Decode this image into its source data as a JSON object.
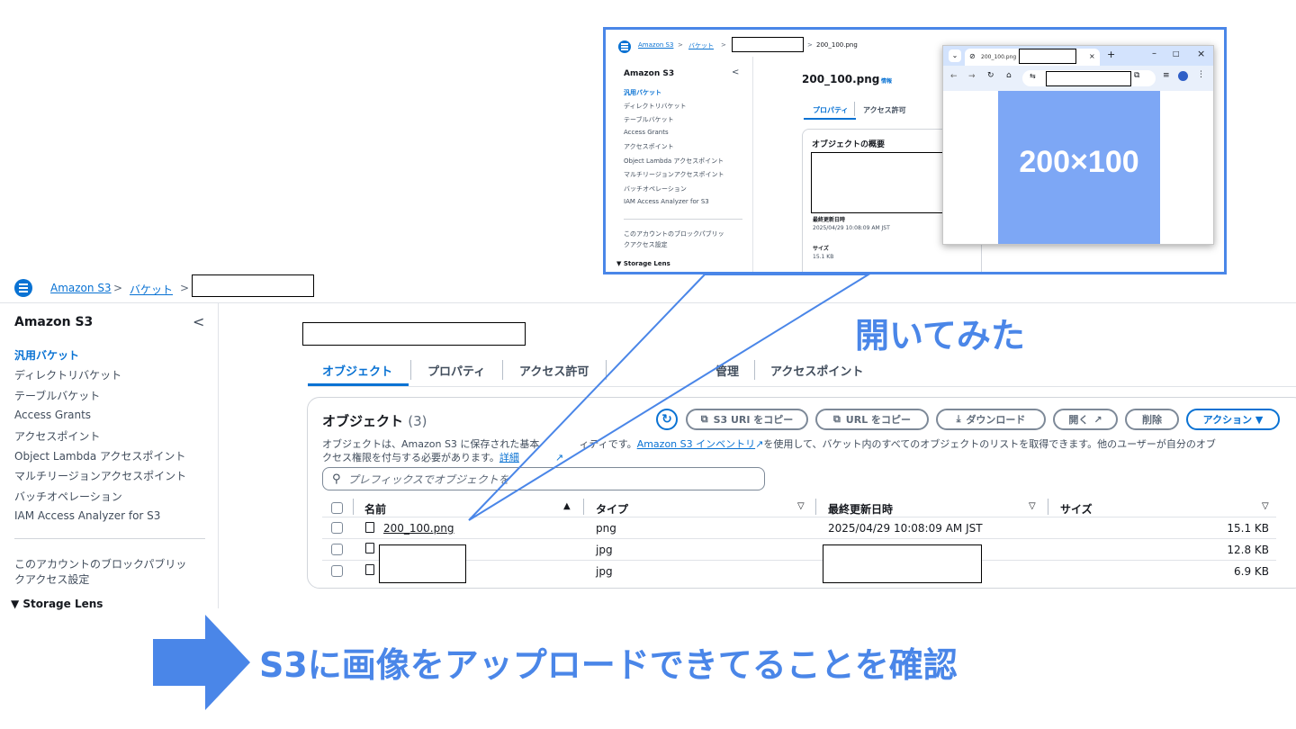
{
  "breadcrumb": {
    "root": "Amazon S3",
    "buckets": "バケット",
    "sep": ">"
  },
  "sidebar": {
    "title": "Amazon S3",
    "collapse_glyph": "<",
    "items": [
      {
        "label": "汎用バケット",
        "active": true
      },
      {
        "label": "ディレクトリバケット"
      },
      {
        "label": "テーブルバケット"
      },
      {
        "label": "Access Grants"
      },
      {
        "label": "アクセスポイント"
      },
      {
        "label": "Object Lambda アクセスポイント"
      },
      {
        "label": "マルチリージョンアクセスポイント"
      },
      {
        "label": "バッチオペレーション"
      },
      {
        "label": "IAM Access Analyzer for S3"
      }
    ],
    "block_public_1": "このアカウントのブロックパブリッ",
    "block_public_2": "クアクセス設定",
    "storage_lens": "▼ Storage Lens"
  },
  "tabs": [
    "オブジェクト",
    "プロパティ",
    "アクセス許可",
    "管理",
    "アクセスポイント"
  ],
  "objects": {
    "title": "オブジェクト",
    "count": "(3)",
    "desc_1a": "オブジェクトは、Amazon S3 に保存された基本",
    "desc_1b": "ィティです。",
    "desc_inventory": "Amazon S3 インベントリ",
    "desc_1c": "を使用して、バケット内のすべてのオブジェクトのリストを取得できます。他のユーザーが自分のオブ",
    "desc_2a": "クセス権限を付与する必要があります。",
    "desc_more": "詳細",
    "buttons": {
      "copy_s3_uri": "S3 URI をコピー",
      "copy_url": "URL をコピー",
      "download": "ダウンロード",
      "open": "開く",
      "delete": "削除",
      "actions": "アクション ▼"
    },
    "search_placeholder": "プレフィックスでオブジェクトを",
    "columns": {
      "name": "名前",
      "type": "タイプ",
      "modified": "最終更新日時",
      "size": "サイズ"
    },
    "rows": [
      {
        "name": "200_100.png",
        "type": "png",
        "modified": "2025/04/29 10:08:09 AM JST",
        "size": "15.1 KB"
      },
      {
        "name": "",
        "type": "jpg",
        "modified": "",
        "size": "12.8 KB"
      },
      {
        "name": "",
        "type": "jpg",
        "modified": "",
        "size": "6.9 KB"
      }
    ]
  },
  "annotations": {
    "opened": "開いてみた",
    "confirm": "S3に画像をアップロードできてることを確認"
  },
  "inset": {
    "breadcrumb_root": "Amazon S3",
    "breadcrumb_buckets": "バケット",
    "breadcrumb_file": "200_100.png",
    "sidebar_title": "Amazon S3",
    "sidebar_items": [
      "汎用バケット",
      "ディレクトリバケット",
      "テーブルバケット",
      "Access Grants",
      "アクセスポイント",
      "Object Lambda アクセスポイント",
      "マルチリージョンアクセスポイント",
      "バッチオペレーション",
      "IAM Access Analyzer for S3"
    ],
    "block_public_1": "このアカウントのブロックパブリッ",
    "block_public_2": "クアクセス設定",
    "storage_lens": "▼ Storage Lens",
    "object_title": "200_100.png",
    "info": "情報",
    "tab_properties": "プロパティ",
    "tab_permissions": "アクセス許可",
    "overview": "オブジェクトの概要",
    "modified_label": "最終更新日時",
    "modified_value": "2025/04/29 10:08:09 AM JST",
    "size_label": "サイズ",
    "size_value": "15.1 KB",
    "browser": {
      "tab_title": "200_100.png",
      "image_text": "200×100"
    }
  }
}
